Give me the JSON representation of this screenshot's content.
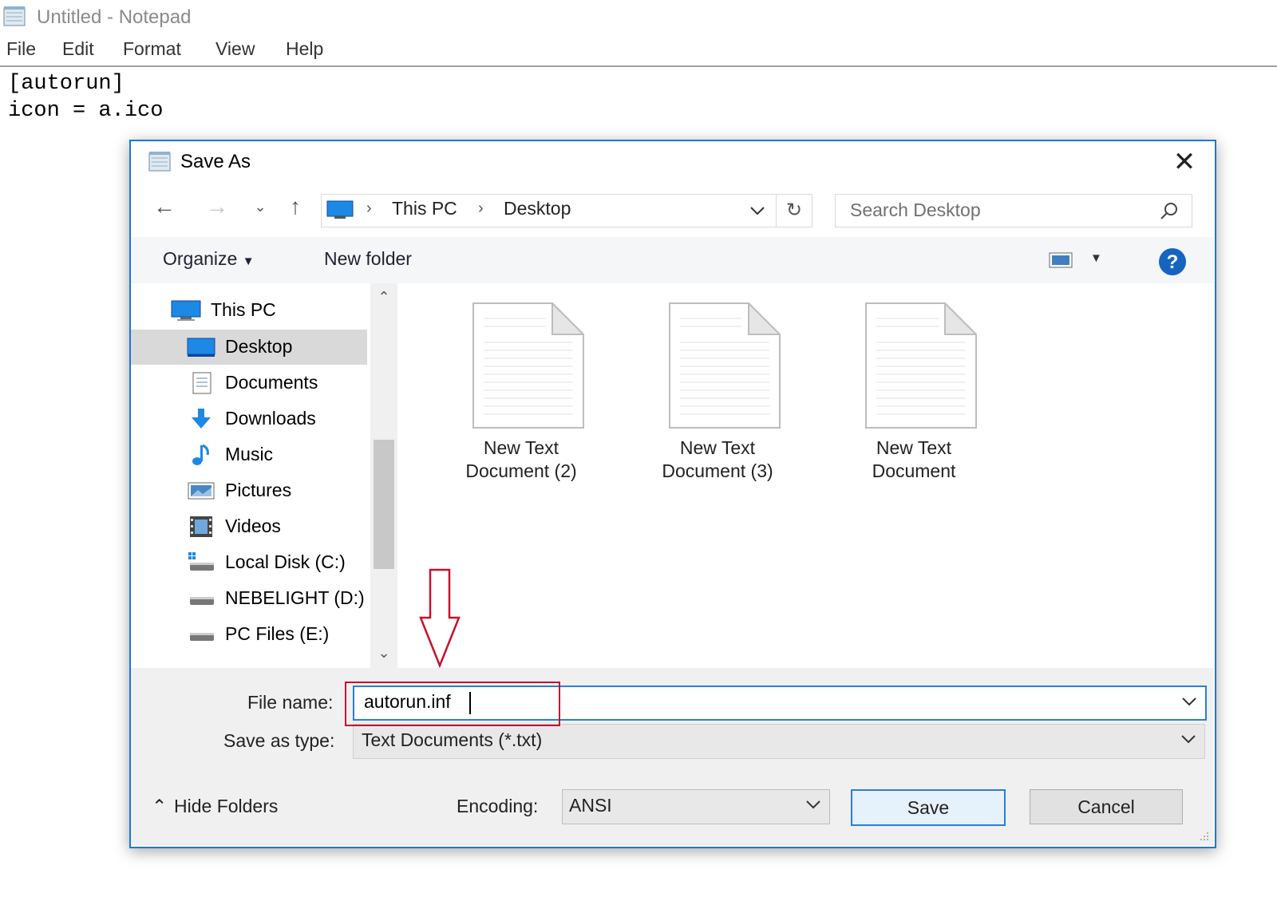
{
  "notepad": {
    "title": "Untitled - Notepad",
    "menu": [
      "File",
      "Edit",
      "Format",
      "View",
      "Help"
    ],
    "content": "[autorun]\nicon = a.ico"
  },
  "dialog": {
    "title": "Save As",
    "breadcrumb": [
      "This PC",
      "Desktop"
    ],
    "search_placeholder": "Search Desktop",
    "toolbar": {
      "organize": "Organize",
      "new_folder": "New folder"
    },
    "nav_root": "This PC",
    "nav_items": [
      {
        "label": "Desktop",
        "icon": "desktop-icon",
        "selected": true
      },
      {
        "label": "Documents",
        "icon": "documents-icon"
      },
      {
        "label": "Downloads",
        "icon": "downloads-icon"
      },
      {
        "label": "Music",
        "icon": "music-icon"
      },
      {
        "label": "Pictures",
        "icon": "pictures-icon"
      },
      {
        "label": "Videos",
        "icon": "videos-icon"
      },
      {
        "label": "Local Disk (C:)",
        "icon": "local-disk-icon"
      },
      {
        "label": "NEBELIGHT (D:)",
        "icon": "drive-icon"
      },
      {
        "label": "PC Files (E:)",
        "icon": "drive-icon"
      }
    ],
    "files": [
      {
        "line1": "New Text",
        "line2": "Document (2)"
      },
      {
        "line1": "New Text",
        "line2": "Document (3)"
      },
      {
        "line1": "New Text",
        "line2": "Document"
      }
    ],
    "file_name_label": "File name:",
    "file_name_value": "autorun.inf",
    "save_type_label": "Save as type:",
    "save_type_value": "Text Documents (*.txt)",
    "encoding_label": "Encoding:",
    "encoding_value": "ANSI",
    "save_label": "Save",
    "cancel_label": "Cancel",
    "hide_folders_label": "Hide Folders"
  },
  "colors": {
    "accent": "#1b78d6",
    "annotation": "#c8102e",
    "help": "#1565c0"
  }
}
